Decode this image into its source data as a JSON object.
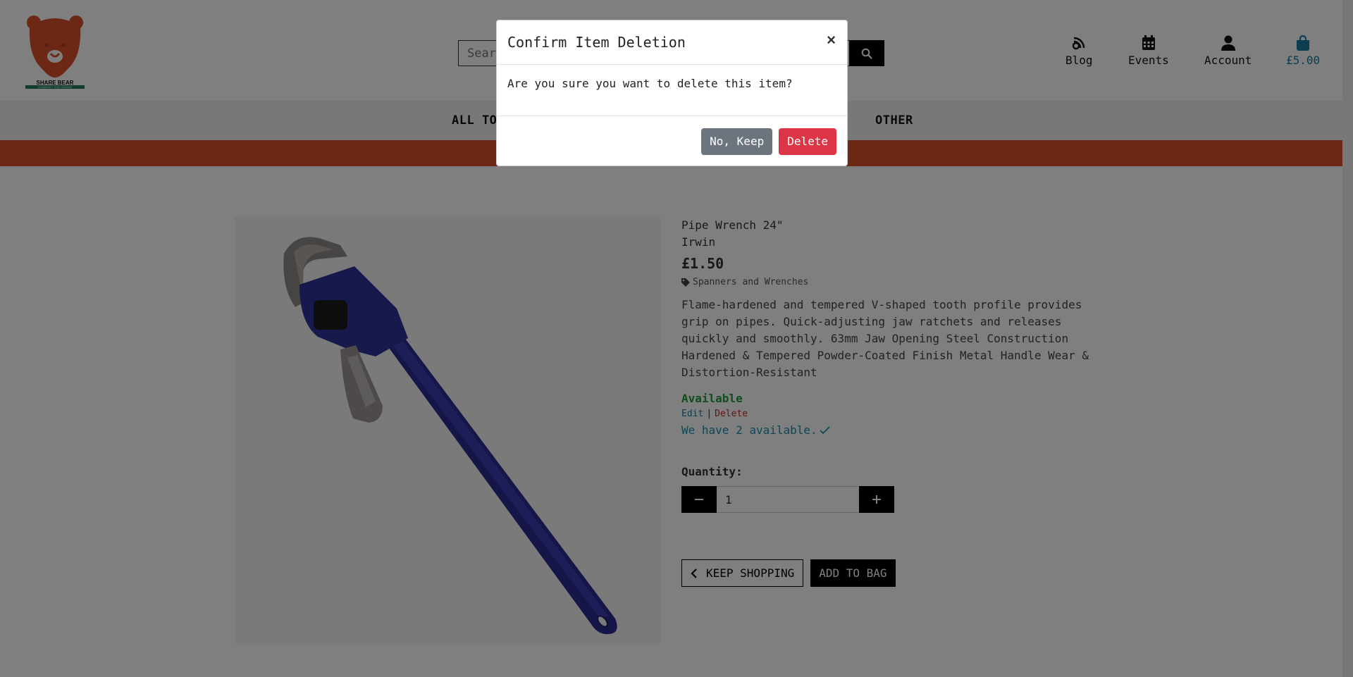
{
  "header": {
    "logo_text": "SHARE BEAR",
    "logo_tagline": "COMMUNITY TOOL SHARING",
    "search_placeholder": "Search",
    "nav": [
      {
        "label": "Blog",
        "icon": "blog-icon"
      },
      {
        "label": "Events",
        "icon": "calendar-icon"
      },
      {
        "label": "Account",
        "icon": "user-icon"
      },
      {
        "label": "£5.00",
        "icon": "shopping-bag-icon"
      }
    ]
  },
  "categories": {
    "all_tools": "ALL TOO",
    "other": "OTHER"
  },
  "product": {
    "name": "Pipe Wrench 24\"",
    "brand": "Irwin",
    "price": "£1.50",
    "category": "Spanners and Wrenches",
    "description": "Flame-hardened and tempered V-shaped tooth profile provides grip on pipes. Quick-adjusting jaw ratchets and releases quickly and smoothly. 63mm Jaw Opening Steel Construction Hardened & Tempered Powder-Coated Finish Metal Handle Wear & Distortion-Resistant",
    "availability": "Available",
    "edit_label": "Edit",
    "separator": "|",
    "delete_label": "Delete",
    "stock_text": "We have 2 available.",
    "quantity_label": "Quantity:",
    "quantity_value": "1",
    "keep_shopping_label": "KEEP SHOPPING",
    "add_to_bag_label": "ADD TO BAG"
  },
  "modal": {
    "title": "Confirm Item Deletion",
    "close_label": "×",
    "body": "Are you sure you want to delete this item?",
    "cancel_label": "No, Keep",
    "confirm_label": "Delete"
  },
  "colors": {
    "brand_orange": "#d84f2b",
    "available_green": "#1f9a3a",
    "link_teal": "#1a7da0",
    "delete_red": "#dc3545",
    "secondary_grey": "#6c757d"
  }
}
